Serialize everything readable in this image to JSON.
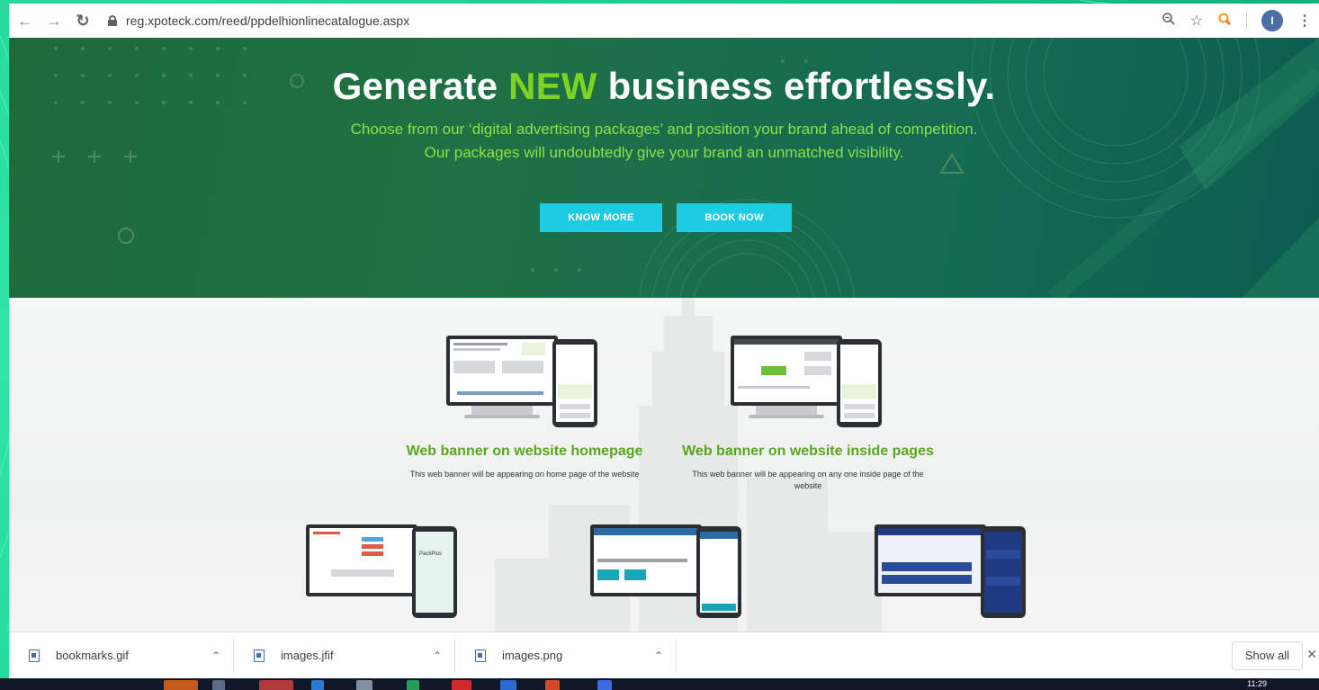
{
  "browser": {
    "url": "reg.xpoteck.com/reed/ppdelhionlinecatalogue.aspx",
    "avatar_letter": "I"
  },
  "hero": {
    "title_before": "Generate ",
    "title_accent": "NEW",
    "title_after": " business effortlessly.",
    "subtitle_line1": "Choose from our ‘digital advertising packages’ and position your brand ahead of competition.",
    "subtitle_line2": "Our packages will undoubtedly give your brand an unmatched visibility.",
    "know_more": "KNOW MORE",
    "book_now": "BOOK NOW",
    "accent_color": "#7ed321",
    "cta_color": "#1ecbe1"
  },
  "packages": [
    {
      "title": "Web banner on website homepage",
      "desc_line1": "This web banner will be appearing on home page of the website",
      "desc_line2": ""
    },
    {
      "title": "Web banner on website inside pages",
      "desc_line1": "This web banner will be appearing on any one inside page of the",
      "desc_line2": "website"
    }
  ],
  "downloads": [
    {
      "name": "bookmarks.gif"
    },
    {
      "name": "images.jfif"
    },
    {
      "name": "images.png"
    }
  ],
  "show_all": "Show all",
  "clock": "11:29"
}
